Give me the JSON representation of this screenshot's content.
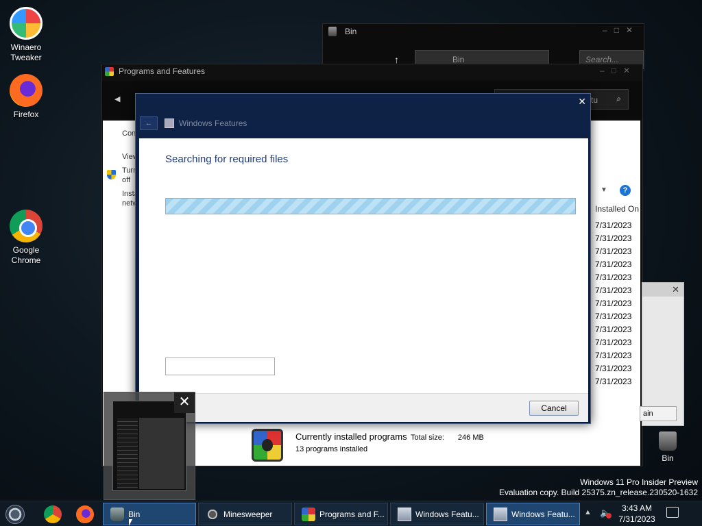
{
  "desktop": {
    "icons": [
      {
        "label": "Winaero Tweaker",
        "icon": "winaero-tweaker-icon"
      },
      {
        "label": "Firefox",
        "icon": "firefox-icon"
      },
      {
        "label": "Google Chrome",
        "icon": "chrome-icon"
      },
      {
        "label": "Bin",
        "icon": "recycle-bin-icon"
      }
    ],
    "watermark": {
      "line1": "Windows 11 Pro Insider Preview",
      "line2": "Evaluation copy. Build 25375.zn_release.230520-1632"
    }
  },
  "bin_window": {
    "title": "Bin",
    "address": "Bin",
    "search_placeholder": "Search..."
  },
  "programs_window": {
    "title": "Programs and Features",
    "search_placeholder": "tu",
    "left_links": [
      "Con",
      "View",
      "Turn off",
      "Install network"
    ],
    "column_installed_on": "Installed On",
    "installed_dates": [
      "7/31/2023",
      "7/31/2023",
      "7/31/2023",
      "7/31/2023",
      "7/31/2023",
      "7/31/2023",
      "7/31/2023",
      "7/31/2023",
      "7/31/2023",
      "7/31/2023",
      "7/31/2023",
      "7/31/2023",
      "7/31/2023"
    ],
    "footer": {
      "currently_installed": "Currently installed programs",
      "total_size_label": "Total size:",
      "total_size_value": "246 MB",
      "count_text": "13 programs installed"
    }
  },
  "features_dialog": {
    "title": "Windows Features",
    "heading": "Searching for required files",
    "progress_state": "indeterminate",
    "cancel_label": "Cancel"
  },
  "small_dialog": {
    "button_label": "ain"
  },
  "taskbar": {
    "tasks": [
      {
        "label": "Bin",
        "icon": "recycle-bin-icon",
        "active": true
      },
      {
        "label": "Minesweeper",
        "icon": "minesweeper-icon",
        "active": false
      },
      {
        "label": "Programs and F...",
        "icon": "programs-features-icon",
        "active": false
      },
      {
        "label": "Windows Featu...",
        "icon": "windows-features-icon",
        "active": false
      },
      {
        "label": "Windows Featu...",
        "icon": "windows-features-icon",
        "active": true
      }
    ],
    "clock": {
      "time": "3:43 AM",
      "date": "7/31/2023"
    }
  }
}
